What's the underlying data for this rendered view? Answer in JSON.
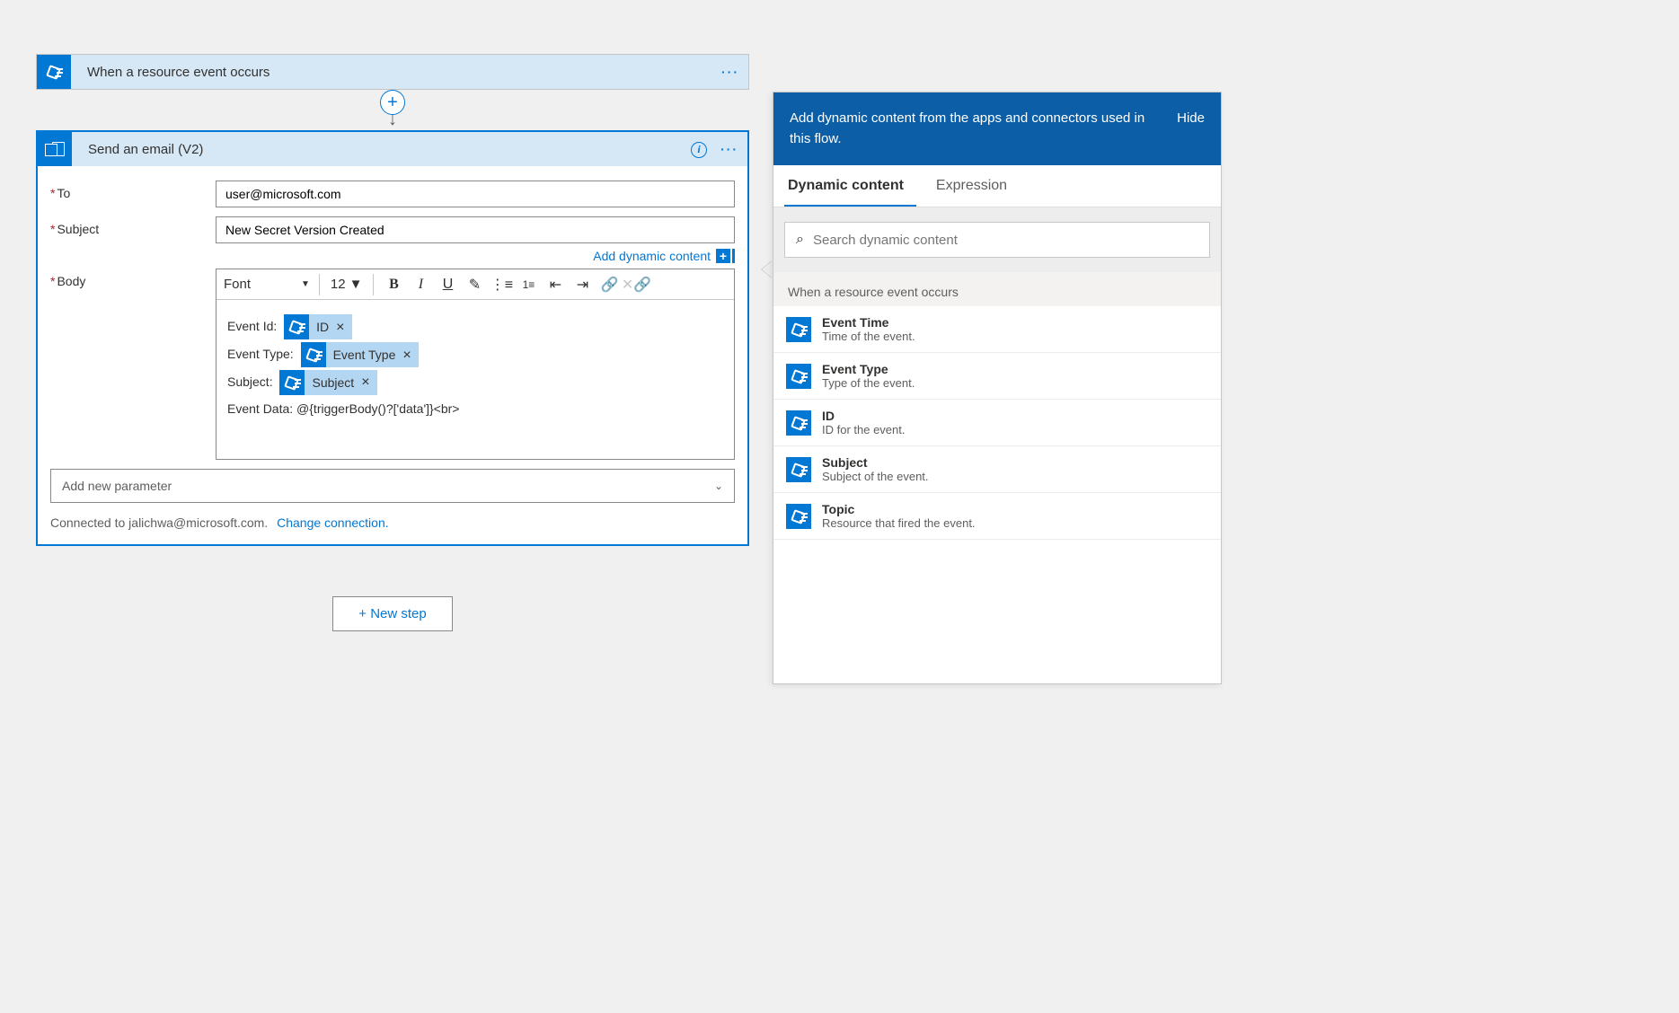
{
  "trigger": {
    "title": "When a resource event occurs"
  },
  "action": {
    "title": "Send an email (V2)",
    "fields": {
      "to_label": "To",
      "to_value": "user@microsoft.com",
      "subject_label": "Subject",
      "subject_value": "New Secret Version Created",
      "body_label": "Body"
    },
    "add_dynamic_content_label": "Add dynamic content",
    "toolbar": {
      "font_label": "Font",
      "font_size": "12"
    },
    "body_content": {
      "line1_label": "Event Id:",
      "token1": "ID",
      "line2_label": "Event Type:",
      "token2": "Event Type",
      "line3_label": "Subject:",
      "token3": "Subject",
      "line4": "Event Data: @{triggerBody()?['data']}<br>"
    },
    "add_parameter_label": "Add new parameter",
    "connected_text": "Connected to jalichwa@microsoft.com.",
    "change_connection_label": "Change connection."
  },
  "new_step_label": "+ New step",
  "panel": {
    "header_text": "Add dynamic content from the apps and connectors used in this flow.",
    "hide_label": "Hide",
    "tab_dynamic": "Dynamic content",
    "tab_expression": "Expression",
    "search_placeholder": "Search dynamic content",
    "section_title": "When a resource event occurs",
    "items": [
      {
        "title": "Event Time",
        "desc": "Time of the event."
      },
      {
        "title": "Event Type",
        "desc": "Type of the event."
      },
      {
        "title": "ID",
        "desc": "ID for the event."
      },
      {
        "title": "Subject",
        "desc": "Subject of the event."
      },
      {
        "title": "Topic",
        "desc": "Resource that fired the event."
      }
    ]
  }
}
